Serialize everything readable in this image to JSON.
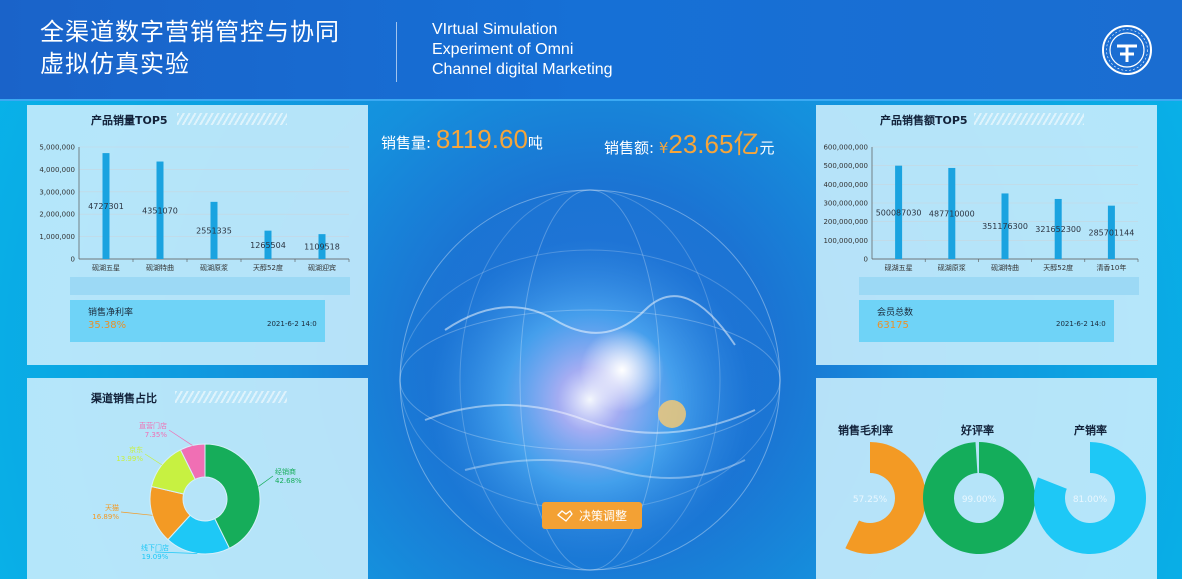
{
  "header": {
    "title_cn_line1": "全渠道数字营销管控与协同",
    "title_cn_line2": "虚拟仿真实验",
    "title_en_line1": "VIrtual Simulation",
    "title_en_line2": "Experiment of Omni",
    "title_en_line3": "Channel digital Marketing",
    "logo_icon": "university-seal-icon"
  },
  "center": {
    "sales_volume_label": "销售量:",
    "sales_volume_value": "8119.60",
    "sales_volume_unit": "吨",
    "sales_amount_label": "销售额:",
    "sales_amount_currency": "¥",
    "sales_amount_value": "23.65",
    "sales_amount_unit_big": "亿",
    "sales_amount_unit": "元",
    "decision_button": "决策调整",
    "decision_icon": "handshake-icon"
  },
  "colors": {
    "accent_orange": "#f3a134",
    "bar_blue": "#1aa3e0",
    "green": "#14ad5b",
    "cyan": "#1ec8f6"
  },
  "panel_sales_volume": {
    "title": "产品销量TOP5",
    "kpi_label": "销售净利率",
    "kpi_value": "35.38%",
    "kpi_time": "2021-6-2 14:0"
  },
  "panel_sales_amount": {
    "title": "产品销售额TOP5",
    "kpi_label": "会员总数",
    "kpi_value": "63175",
    "kpi_time": "2021-6-2 14:0"
  },
  "panel_channel": {
    "title": "渠道销售占比"
  },
  "panel_gauges": {
    "gauges": [
      {
        "title": "销售毛利率",
        "value_label": "57.25%",
        "value": 0.5725,
        "color": "#f39a24"
      },
      {
        "title": "好评率",
        "value_label": "99.00%",
        "value": 0.99,
        "color": "#14ad5b"
      },
      {
        "title": "产销率",
        "value_label": "81.00%",
        "value": 0.81,
        "color": "#1ec8f6"
      }
    ]
  },
  "chart_data": [
    {
      "type": "bar",
      "title": "产品销量TOP5",
      "categories": [
        "砚湖五星",
        "砚湖特曲",
        "砚湖原浆",
        "天醇52度",
        "砚湖迎宾"
      ],
      "values": [
        4727301,
        4351070,
        2551335,
        1265504,
        1109518
      ],
      "value_labels": [
        "4727301",
        "4351070",
        "2551335",
        "1265504",
        "1109518"
      ],
      "yticks": [
        "0",
        "1,000,000",
        "2,000,000",
        "3,000,000",
        "4,000,000",
        "5,000,000"
      ],
      "ylim": [
        0,
        5000000
      ]
    },
    {
      "type": "bar",
      "title": "产品销售额TOP5",
      "categories": [
        "砚湖五星",
        "砚湖原浆",
        "砚湖特曲",
        "天醇52度",
        "清香10年"
      ],
      "values": [
        500087030,
        487710000,
        351176300,
        321652300,
        285701144
      ],
      "value_labels": [
        "500087030",
        "487710000",
        "351176300",
        "321652300",
        "285701144"
      ],
      "yticks": [
        "0",
        "100,000,000",
        "200,000,000",
        "300,000,000",
        "400,000,000",
        "500,000,000",
        "600,000,000"
      ],
      "ylim": [
        0,
        600000000
      ]
    },
    {
      "type": "pie",
      "title": "渠道销售占比",
      "slices": [
        {
          "name": "经销商",
          "value": 42.68,
          "label": "42.68%",
          "color": "#16ad5a"
        },
        {
          "name": "线下门店",
          "value": 19.09,
          "label": "19.09%",
          "color": "#1ec8f6"
        },
        {
          "name": "天猫",
          "value": 16.89,
          "label": "16.89%",
          "color": "#f39a24"
        },
        {
          "name": "京东",
          "value": 13.99,
          "label": "13.99%",
          "color": "#c7f141"
        },
        {
          "name": "直营门店",
          "value": 7.35,
          "label": "7.35%",
          "color": "#f06fb4"
        }
      ]
    }
  ]
}
